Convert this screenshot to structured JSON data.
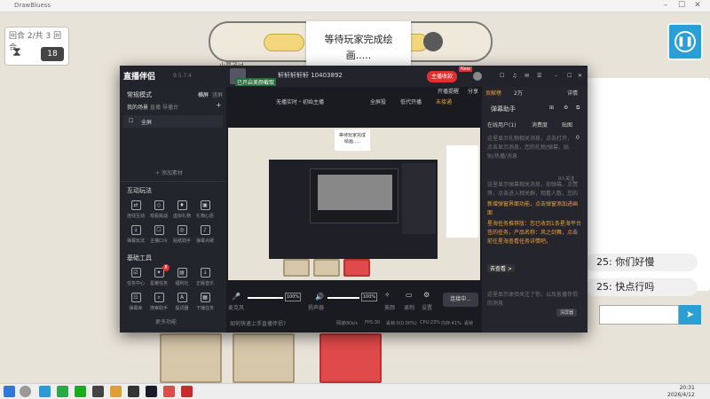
{
  "game_window": {
    "title": "DrawBluess",
    "round_label": "回合 2/共 3 回合",
    "timer": "18",
    "player_name": "小栗子Id",
    "waiting_text": "等待玩家完成绘画.....",
    "chat_messages": [
      "25: 你们好慢",
      "25: 快点行吗"
    ],
    "send_icon": "send-icon"
  },
  "taskbar": {
    "time": "20:31",
    "date": "2026/4/12"
  },
  "app": {
    "logo": "直播伴侣",
    "version": "9.5.7.4",
    "scene_section": {
      "mode": "常规模式",
      "tabs": [
        "横屏",
        "竖屏"
      ],
      "scene_tabs": [
        "我的场景",
        "直播",
        "导播台"
      ],
      "scene_item": "全屏",
      "add_source": "+ 添加素材"
    },
    "interactive_section": {
      "title": "互动玩法",
      "items": [
        "连线互动",
        "观看挑战",
        "虚拟礼物",
        "礼物心愿",
        "弹幕玩法",
        "主播口令",
        "贴纸助手",
        "弹幕点歌"
      ]
    },
    "tools_section": {
      "title": "基础工具",
      "items": [
        "任务中心",
        "星耀任务",
        "福利社",
        "正版音乐",
        "弹幕库",
        "搜索助手",
        "提词器",
        "下播任务"
      ],
      "badge": "8",
      "more": "更多功能"
    },
    "live_header": {
      "title": "轩轩轩轩轩 10403892",
      "alert": "已开启美颜截取",
      "sub_btn1": "无播实时・初始主播",
      "sub_btn2": "全屏投",
      "sub_btn3": "低代开播",
      "sub_btn4": "未接通",
      "status_button": "主播收款",
      "status_badge": "New"
    },
    "top_right": {
      "open": "开播提醒",
      "share": "分享",
      "contribution": "贡献榜",
      "wan": "2万",
      "detail": "详情"
    },
    "bottom_bar": {
      "mic_label": "麦克风",
      "mic_value": "100%",
      "speaker_label": "扬声器",
      "speaker_value": "100%",
      "beauty_label": "美颜",
      "record_label": "录制",
      "settings_label": "设置",
      "connect_label": "连接中...",
      "help": "如何快速上手直播伴侣?"
    },
    "status_bar": {
      "net": "网速0Kb/s",
      "fps": "FPS:30",
      "drop": "丢帧:0(0.00%)",
      "cpu": "CPU:23%",
      "mem": "内存:41%",
      "drop2": "丢帧"
    },
    "right_panel": {
      "title": "弹幕助手",
      "tabs": [
        "在线用户(1)",
        "消费度",
        "贴图"
      ],
      "count": "0",
      "hint1": "这里显示礼物相关消息，点击打开，点击显示消息，您的礼物/弹幕，贴贴/热播/消息",
      "users_badge": "0人关注",
      "hint2": "这里显示弹幕相关消息，如弹幕、点赞等，点击进入相关群，观看人数，您的礼物弹幕",
      "highlight1": "新增弹窗界面功能，点击弹窗添加进画面",
      "highlight2": "星海任务推荐版：您已收到1条星海平台签的任务，产品名称：风之剑舞，点击前往星海查看任务详情吧。",
      "see_link": "去查看 >",
      "hint3": "这里显示体验关注了你，以及放播伴侣的消息",
      "clear_btn": "清屏器"
    }
  }
}
